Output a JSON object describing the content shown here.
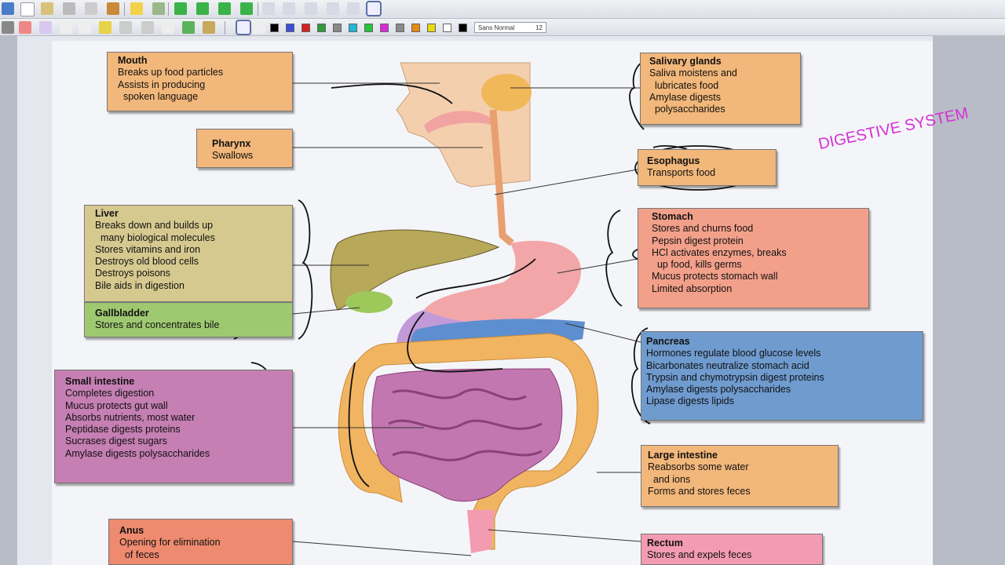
{
  "toolbar": {
    "zoom_label": "Sans Normal",
    "zoom_value": "12",
    "colors": [
      "#000000",
      "#3a4fd8",
      "#d42020",
      "#2f9a3a",
      "#8a8a8a",
      "#21b8d8",
      "#27c43a",
      "#d82ad8",
      "#8a8a8a",
      "#e88a10",
      "#e8d810",
      "#ffffff",
      "#000000"
    ]
  },
  "title": "DIGESTIVE SYSTEM",
  "boxes": {
    "mouth": {
      "heading": "Mouth",
      "lines": [
        "Breaks up food particles",
        "Assists in producing",
        "  spoken language"
      ]
    },
    "pharynx": {
      "heading": "Pharynx",
      "lines": [
        "Swallows"
      ]
    },
    "liver": {
      "heading": "Liver",
      "lines": [
        "Breaks down and builds up",
        "  many biological molecules",
        "Stores vitamins and iron",
        "Destroys old blood cells",
        "Destroys poisons",
        "Bile aids in digestion"
      ]
    },
    "gallbladder": {
      "heading": "Gallbladder",
      "lines": [
        "Stores and concentrates bile"
      ]
    },
    "small_intestine": {
      "heading": "Small intestine",
      "lines": [
        "Completes digestion",
        "Mucus protects gut wall",
        "Absorbs nutrients, most water",
        "Peptidase digests proteins",
        "Sucrases digest sugars",
        "Amylase digests polysaccharides"
      ]
    },
    "anus": {
      "heading": "Anus",
      "lines": [
        "Opening for elimination",
        "  of feces"
      ]
    },
    "salivary": {
      "heading": "Salivary glands",
      "lines": [
        "Saliva moistens and",
        "  lubricates food",
        "Amylase digests",
        "  polysaccharides"
      ]
    },
    "esophagus": {
      "heading": "Esophagus",
      "lines": [
        "Transports food"
      ]
    },
    "stomach": {
      "heading": "Stomach",
      "lines": [
        "Stores and churns food",
        "Pepsin digest protein",
        "HCl activates enzymes, breaks",
        "  up food, kills germs",
        "Mucus protects stomach wall",
        "Limited absorption"
      ]
    },
    "pancreas": {
      "heading": "Pancreas",
      "lines": [
        "Hormones regulate blood glucose levels",
        "Bicarbonates neutralize stomach acid",
        "Trypsin and chymotrypsin digest proteins",
        "Amylase digests polysaccharides",
        "Lipase digests lipids"
      ]
    },
    "large_intestine": {
      "heading": "Large intestine",
      "lines": [
        "Reabsorbs some water",
        "  and ions",
        "Forms and stores feces"
      ]
    },
    "rectum": {
      "heading": "Rectum",
      "lines": [
        "Stores and expels feces"
      ]
    }
  }
}
